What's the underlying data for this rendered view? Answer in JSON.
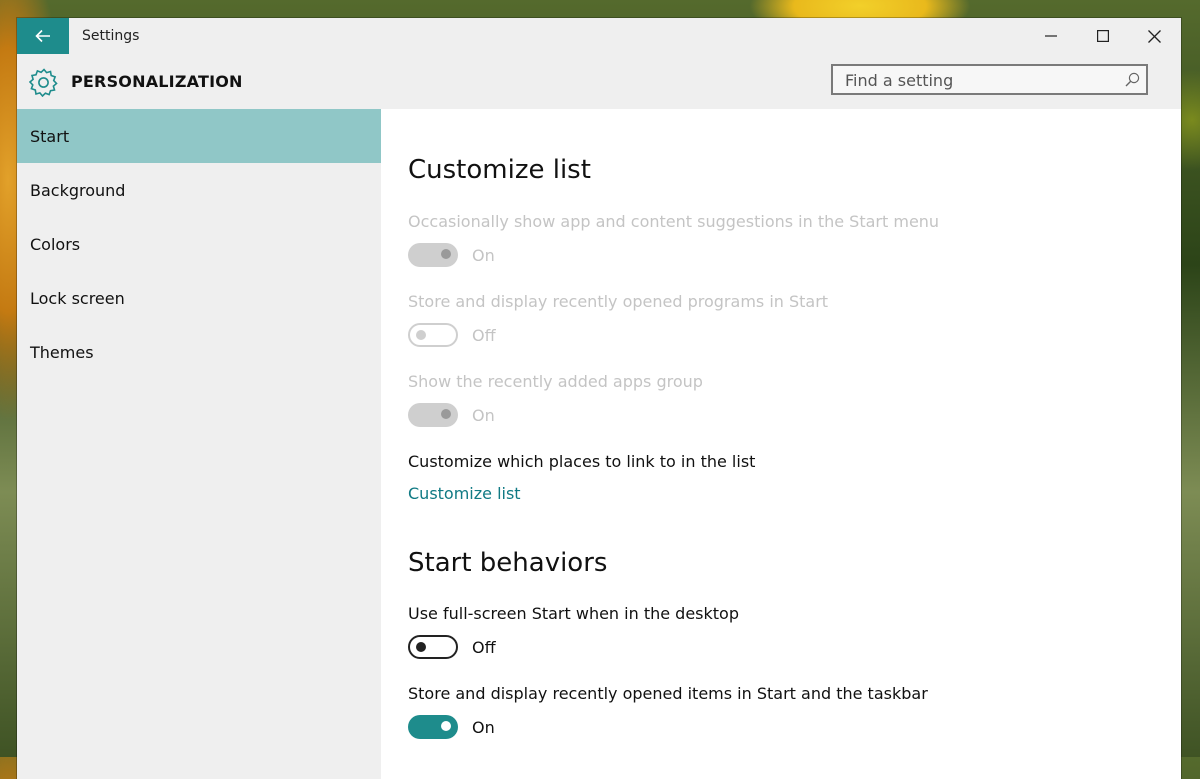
{
  "window": {
    "title": "Settings",
    "back_icon": "back-arrow-icon",
    "controls": [
      "minimize-icon",
      "maximize-icon",
      "close-icon"
    ]
  },
  "header": {
    "icon": "gear-icon",
    "title": "PERSONALIZATION",
    "search": {
      "placeholder": "Find a setting",
      "icon": "search-icon"
    }
  },
  "sidebar": {
    "items": [
      {
        "label": "Start",
        "selected": true
      },
      {
        "label": "Background",
        "selected": false
      },
      {
        "label": "Colors",
        "selected": false
      },
      {
        "label": "Lock screen",
        "selected": false
      },
      {
        "label": "Themes",
        "selected": false
      }
    ]
  },
  "main": {
    "section1": {
      "title": "Customize list",
      "settings": [
        {
          "label": "Occasionally show app and content suggestions in the Start menu",
          "state": "On",
          "enabled": false
        },
        {
          "label": "Store and display recently opened programs in Start",
          "state": "Off",
          "enabled": false
        },
        {
          "label": "Show the recently added apps group",
          "state": "On",
          "enabled": false
        }
      ],
      "places_label": "Customize which places to link to in the list",
      "link": "Customize list"
    },
    "section2": {
      "title": "Start behaviors",
      "settings": [
        {
          "label": "Use full-screen Start when in the desktop",
          "state": "Off",
          "enabled": true
        },
        {
          "label": "Store and display recently opened items in Start and the taskbar",
          "state": "On",
          "enabled": true
        }
      ]
    }
  },
  "colors": {
    "accent": "#1e8c8c",
    "selected_nav": "#90c7c7",
    "link": "#107a84",
    "disabled": "#c4c4c4"
  }
}
